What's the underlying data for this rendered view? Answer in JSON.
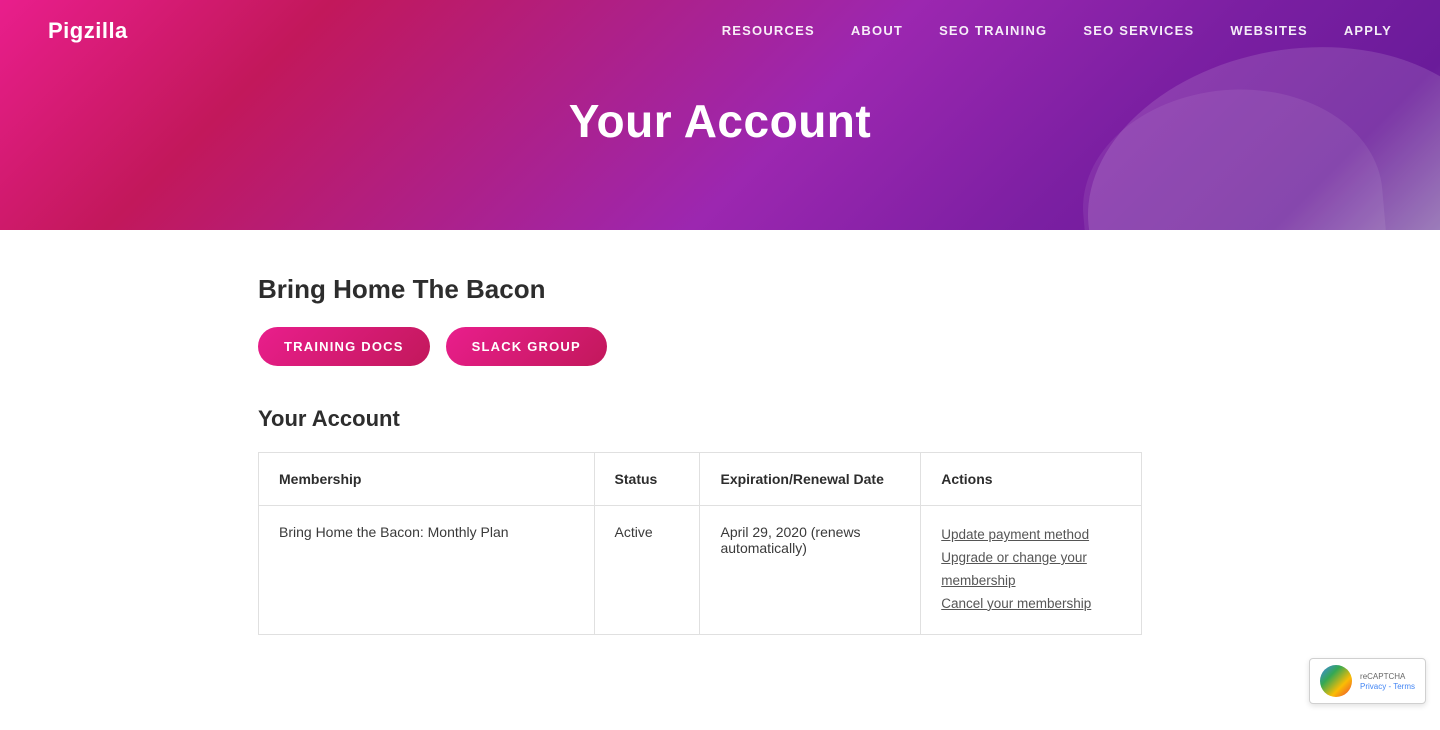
{
  "site": {
    "logo": "Pigzilla"
  },
  "nav": {
    "links": [
      {
        "label": "RESOURCES",
        "id": "resources"
      },
      {
        "label": "ABOUT",
        "id": "about"
      },
      {
        "label": "SEO TRAINING",
        "id": "seo-training"
      },
      {
        "label": "SEO SERVICES",
        "id": "seo-services"
      },
      {
        "label": "WEBSITES",
        "id": "websites"
      },
      {
        "label": "APPLY",
        "id": "apply"
      }
    ]
  },
  "header": {
    "title": "Your Account"
  },
  "content": {
    "membership_title": "Bring Home The Bacon",
    "buttons": [
      {
        "label": "TRAINING DOCS",
        "id": "training-docs"
      },
      {
        "label": "SLACK GROUP",
        "id": "slack-group"
      }
    ],
    "account_section_title": "Your Account",
    "table": {
      "headers": [
        "Membership",
        "Status",
        "Expiration/Renewal Date",
        "Actions"
      ],
      "rows": [
        {
          "membership": "Bring Home the Bacon: Monthly Plan",
          "status": "Active",
          "expiry": "April 29, 2020 (renews automatically)",
          "actions": [
            {
              "label": "Update payment method",
              "id": "update-payment"
            },
            {
              "label": "Upgrade or change your membership",
              "id": "upgrade-membership"
            },
            {
              "label": "Cancel your membership",
              "id": "cancel-membership"
            }
          ]
        }
      ]
    }
  },
  "recaptcha": {
    "text": "reCAPTCHA",
    "links": "Privacy - Terms"
  }
}
